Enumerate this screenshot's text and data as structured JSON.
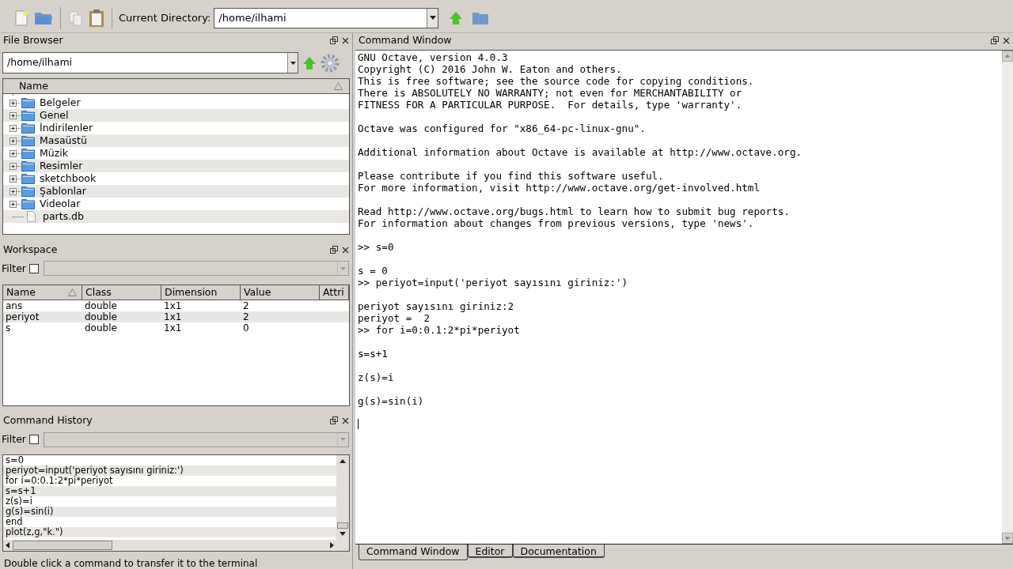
{
  "toolbar": {
    "directory_label": "Current Directory:",
    "directory": "/home/ilhami"
  },
  "file_browser": {
    "title": "File Browser",
    "path": "/home/ilhami",
    "column": "Name",
    "items": [
      {
        "name": "Belgeler",
        "kind": "folder"
      },
      {
        "name": "Genel",
        "kind": "folder"
      },
      {
        "name": "İndirilenler",
        "kind": "folder"
      },
      {
        "name": "Masaüstü",
        "kind": "folder"
      },
      {
        "name": "Müzik",
        "kind": "folder"
      },
      {
        "name": "Resimler",
        "kind": "folder"
      },
      {
        "name": "sketchbook",
        "kind": "folder"
      },
      {
        "name": "Şablonlar",
        "kind": "folder"
      },
      {
        "name": "Videolar",
        "kind": "folder"
      },
      {
        "name": "parts.db",
        "kind": "file"
      }
    ]
  },
  "workspace": {
    "title": "Workspace",
    "filter_label": "Filter",
    "filter_checked": false,
    "columns": [
      "Name",
      "Class",
      "Dimension",
      "Value",
      "Attri"
    ],
    "rows": [
      [
        "ans",
        "double",
        "1x1",
        "2"
      ],
      [
        "periyot",
        "double",
        "1x1",
        "2"
      ],
      [
        "s",
        "double",
        "1x1",
        "0"
      ]
    ]
  },
  "command_history": {
    "title": "Command History",
    "filter_label": "Filter",
    "filter_checked": false,
    "items": [
      "s=0",
      "periyot=input('periyot sayısını giriniz:')",
      "for i=0:0.1:2*pi*periyot",
      "s=s+1",
      "z(s)=i",
      "g(s)=sin(i)",
      "end",
      "plot(z,g,\"k.\")"
    ],
    "hint": "Double click a command to transfer it to the terminal"
  },
  "command_window": {
    "title": "Command Window",
    "blocks": [
      [
        "GNU Octave, version 4.0.3",
        "Copyright (C) 2016 John W. Eaton and others.",
        "This is free software; see the source code for copying conditions.",
        "There is ABSOLUTELY NO WARRANTY; not even for MERCHANTABILITY or",
        "FITNESS FOR A PARTICULAR PURPOSE.  For details, type 'warranty'."
      ],
      [
        "Octave was configured for \"x86_64-pc-linux-gnu\"."
      ],
      [
        "Additional information about Octave is available at http://www.octave.org."
      ],
      [
        "Please contribute if you find this software useful.",
        "For more information, visit http://www.octave.org/get-involved.html"
      ],
      [
        "Read http://www.octave.org/bugs.html to learn how to submit bug reports.",
        "For information about changes from previous versions, type 'news'."
      ],
      [
        ">> s=0"
      ],
      [
        "s = 0",
        ">> periyot=input('periyot sayısını giriniz:')"
      ],
      [
        "periyot sayısını giriniz:2",
        "periyot =  2",
        ">> for i=0:0.1:2*pi*periyot"
      ],
      [
        "s=s+1"
      ],
      [
        "z(s)=i"
      ],
      [
        "g(s)=sin(i)"
      ]
    ]
  },
  "tabs": [
    {
      "label": "Command Window",
      "selected": true
    },
    {
      "label": "Editor",
      "selected": false
    },
    {
      "label": "Documentation",
      "selected": false
    }
  ]
}
